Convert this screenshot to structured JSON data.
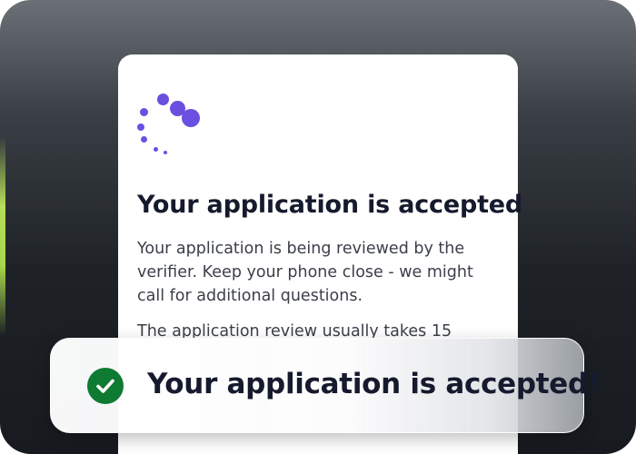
{
  "card": {
    "title": "Your application is accepted",
    "paragraph_1": "Your application is being reviewed by the verifier. Keep your phone close - we might call for additional questions.",
    "paragraph_2": "The application review usually takes 15",
    "spinner_icon": "loading-spinner-icon"
  },
  "toast": {
    "message": "Your application is accepted!",
    "icon": "check-circle-icon"
  },
  "colors": {
    "accent": "#6a4fe0",
    "success": "#0e7a32",
    "heading": "#151a2d",
    "body_text": "#3b3f48",
    "edge_highlight": "#b6de5a"
  }
}
